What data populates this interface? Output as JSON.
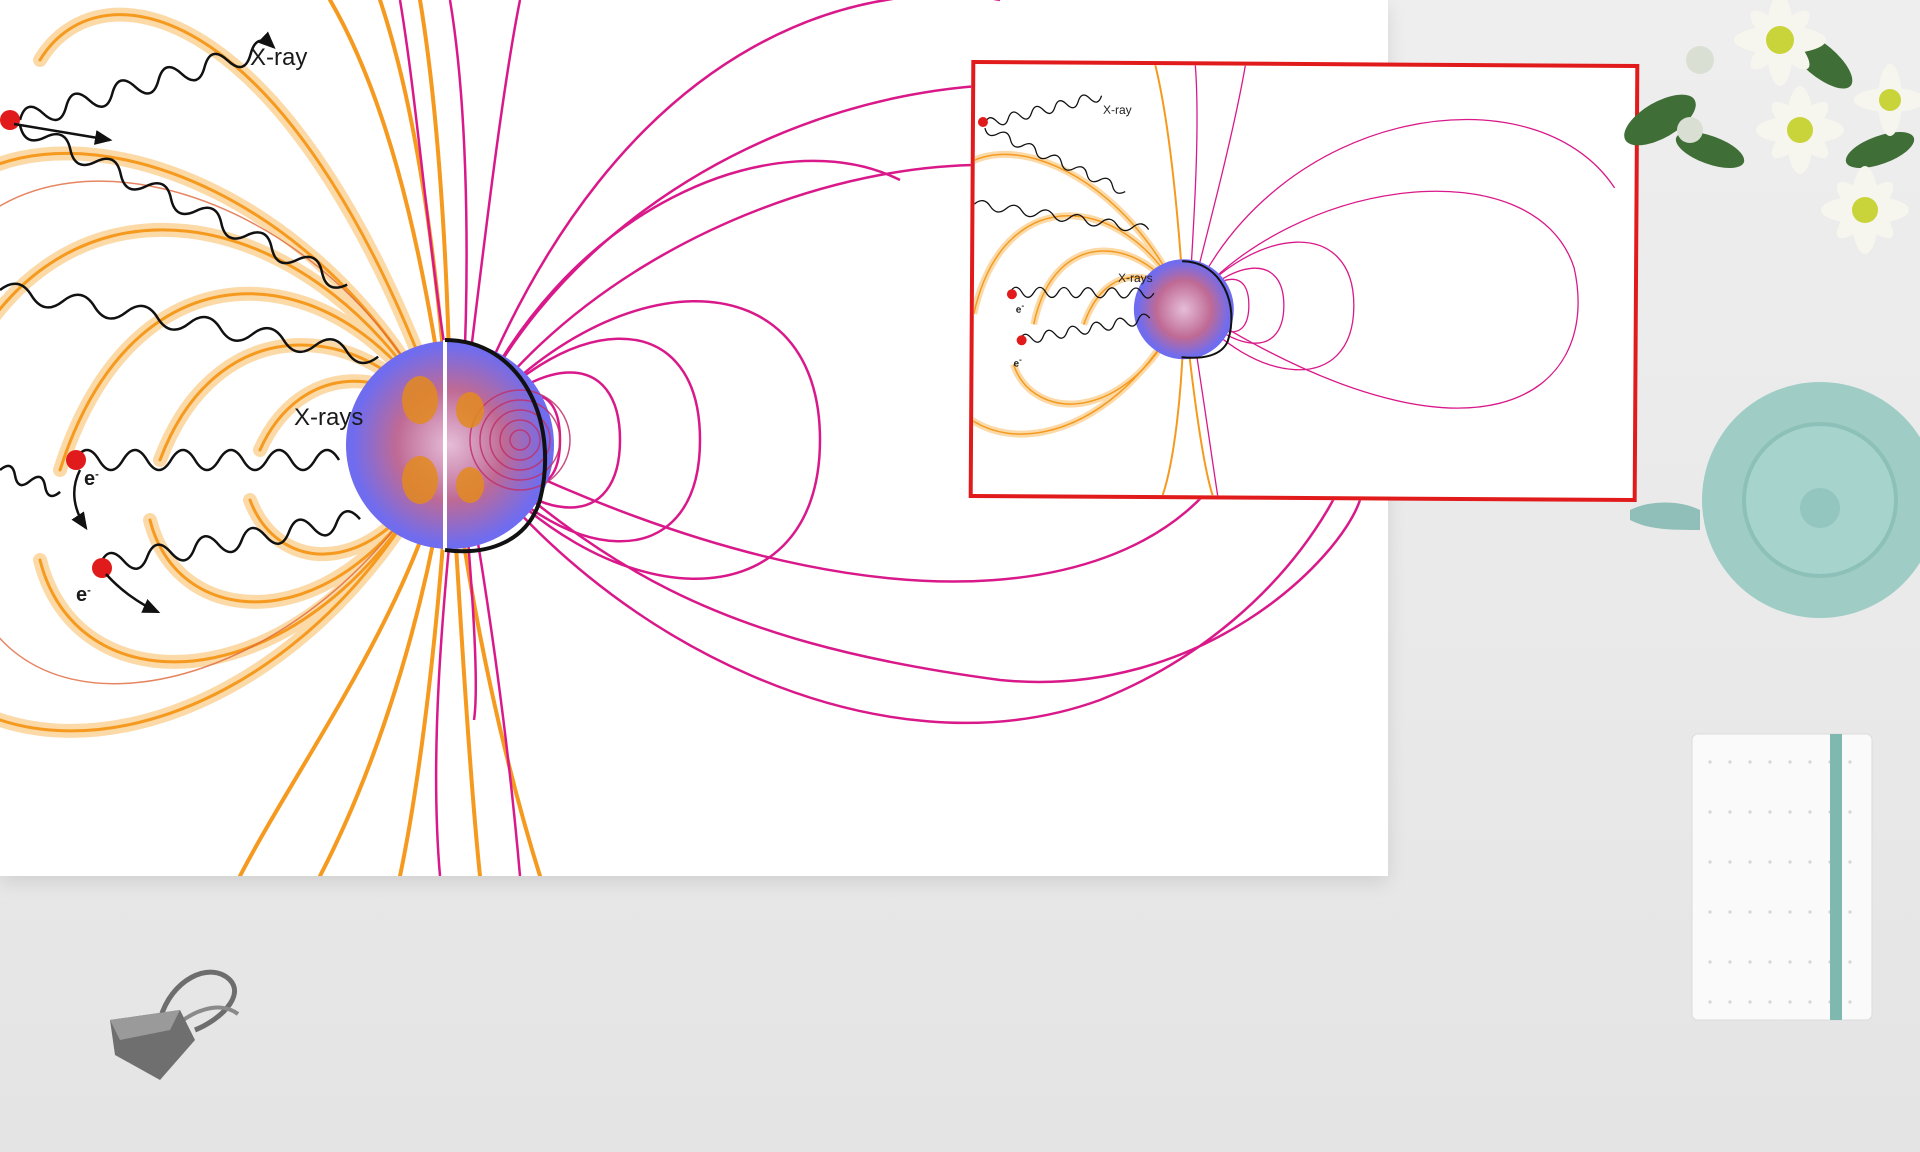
{
  "diagram": {
    "labels": {
      "xray": "X-ray",
      "xrays": "X-rays",
      "electron": "e",
      "electron_sup": "-"
    }
  },
  "inset": {
    "labels": {
      "xray": "X-ray",
      "xrays": "X-rays",
      "electron": "e",
      "electron_sup": "-"
    }
  },
  "colors": {
    "orange_loops": "#f7a02a",
    "orange_glow": "#fbd49a",
    "magenta_lines": "#d9198a",
    "star_blue": "#6f6cf0",
    "inset_border": "#e11b1b",
    "teapot": "#9fcdc6",
    "notebook_band": "#7fb8ae"
  },
  "scene": {
    "props": [
      "flower-bouquet",
      "teapot",
      "notebook",
      "binder-clip"
    ]
  }
}
